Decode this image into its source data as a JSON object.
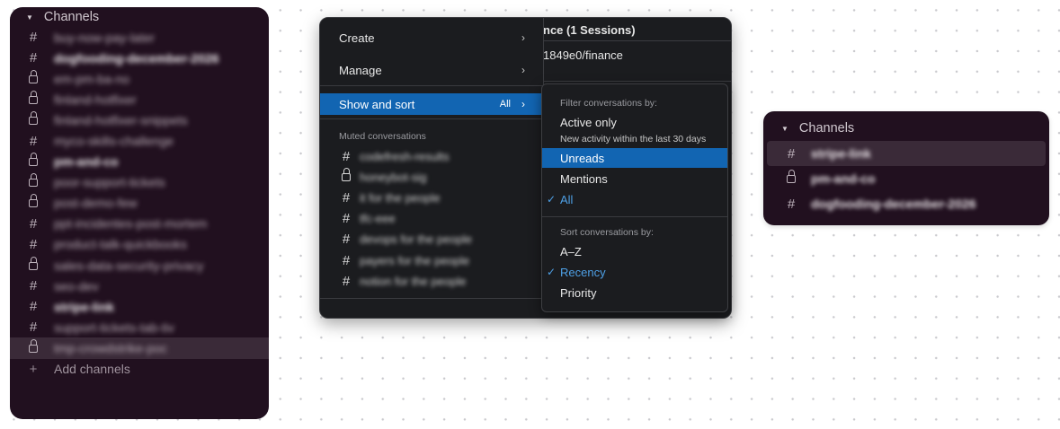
{
  "panel_left": {
    "header": "Channels",
    "channels": [
      {
        "type": "hash",
        "name": "buy-now-pay-later",
        "bold": false
      },
      {
        "type": "hash",
        "name": "dogfooding-december-2026",
        "bold": true
      },
      {
        "type": "lock",
        "name": "em-pm-ba-no",
        "bold": false
      },
      {
        "type": "lock",
        "name": "finland-hotfixer",
        "bold": false
      },
      {
        "type": "lock",
        "name": "finland-hotfixer-snippets",
        "bold": false
      },
      {
        "type": "hash",
        "name": "myco-skills-challenge",
        "bold": false
      },
      {
        "type": "lock",
        "name": "pm-and-co",
        "bold": true
      },
      {
        "type": "lock",
        "name": "poor-support-tickets",
        "bold": false
      },
      {
        "type": "lock",
        "name": "post-demo-few",
        "bold": false
      },
      {
        "type": "hash",
        "name": "ppt-incidentes-post-mortem",
        "bold": false
      },
      {
        "type": "hash",
        "name": "product-talk-quickbooks",
        "bold": false
      },
      {
        "type": "lock",
        "name": "sales-data-security-privacy",
        "bold": false
      },
      {
        "type": "hash",
        "name": "seo-dev",
        "bold": false
      },
      {
        "type": "hash",
        "name": "stripe-link",
        "bold": true
      },
      {
        "type": "hash",
        "name": "support-tickets-tab-tiv",
        "bold": false
      },
      {
        "type": "lock",
        "name": "tmp-crowdstrike-poc",
        "bold": false,
        "active": true
      }
    ],
    "partial_label": "Add channels"
  },
  "menu_window": {
    "bg_title_suffix": "nce (1 Sessions)",
    "bg_path": "1849e0/finance",
    "menu": {
      "create": "Create",
      "manage": "Manage",
      "show_and_sort": "Show and sort",
      "show_and_sort_tag": "All",
      "arrow": "›",
      "muted_header": "Muted conversations",
      "muted": [
        {
          "type": "hash",
          "name": "codefresh-results"
        },
        {
          "type": "lock",
          "name": "honeybot-sig"
        },
        {
          "type": "hash",
          "name": "it for the people"
        },
        {
          "type": "hash",
          "name": "tfc-eee"
        },
        {
          "type": "hash",
          "name": "devops for the people"
        },
        {
          "type": "hash",
          "name": "payers for the people"
        },
        {
          "type": "hash",
          "name": "notion for the people"
        }
      ]
    },
    "submenu": {
      "filter_label": "Filter conversations by:",
      "active_only": "Active only",
      "active_only_sub": "New activity within the last 30 days",
      "unreads": "Unreads",
      "mentions": "Mentions",
      "all": "All",
      "sort_label": "Sort conversations by:",
      "az": "A–Z",
      "recency": "Recency",
      "priority": "Priority",
      "check": "✓"
    }
  },
  "panel_right": {
    "header": "Channels",
    "channels": [
      {
        "type": "hash",
        "name": "stripe-link"
      },
      {
        "type": "lock",
        "name": "pm-and-co"
      },
      {
        "type": "hash",
        "name": "dogfooding-december-2026"
      }
    ]
  },
  "colors": {
    "sidebar_bg": "#21101f",
    "menu_bg": "#1b1c1f",
    "accent_blue": "#1265b2",
    "check_blue": "#4ea0e6"
  }
}
